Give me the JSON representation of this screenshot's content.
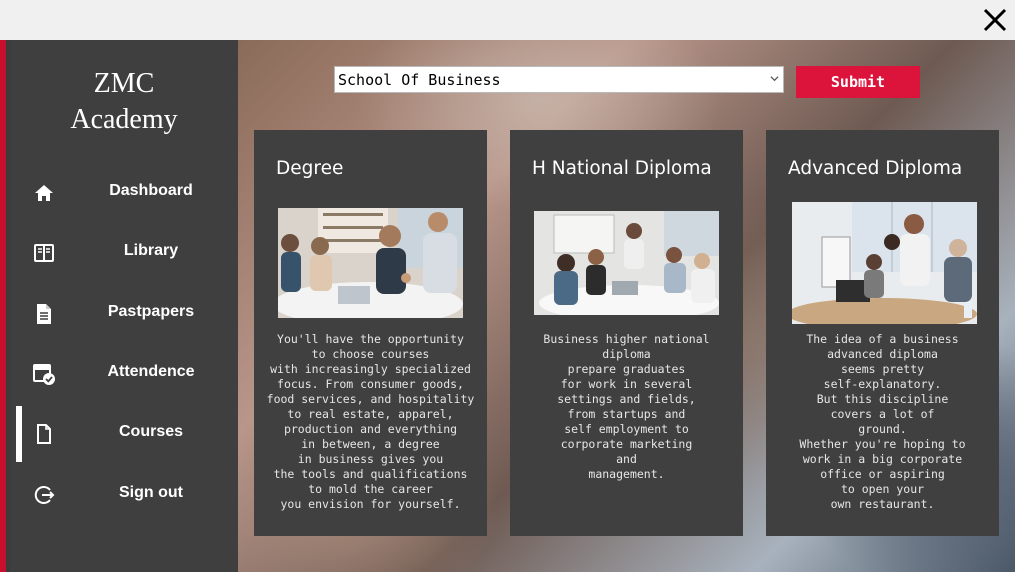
{
  "window": {
    "close_icon": "close-x-icon"
  },
  "sidebar": {
    "brand_line1": "ZMC",
    "brand_line2": "Academy",
    "items": [
      {
        "label": "Dashboard",
        "icon": "home-icon"
      },
      {
        "label": "Library",
        "icon": "book-icon"
      },
      {
        "label": "Pastpapers",
        "icon": "document-icon"
      },
      {
        "label": "Attendence",
        "icon": "calendar-check-icon"
      },
      {
        "label": "Courses",
        "icon": "file-icon",
        "active": true
      },
      {
        "label": "Sign out",
        "icon": "sign-out-icon"
      }
    ]
  },
  "course_select": {
    "value": "School Of Business"
  },
  "submit_label": "Submit",
  "cards": [
    {
      "title": "Degree",
      "photo": "business-meeting-photo",
      "text": "You'll have the opportunity\nto choose courses\nwith increasingly specialized\nfocus. From consumer goods,\nfood services, and hospitality\nto real estate, apparel,\nproduction and everything\nin between, a degree\nin business gives you\nthe tools and qualifications\nto mold the career\nyou envision for yourself."
    },
    {
      "title": "H National Diploma",
      "photo": "team-meeting-photo",
      "text": "Business higher national\ndiploma\nprepare graduates\nfor work in several\nsettings and fields,\nfrom startups and\nself employment to\ncorporate marketing\nand\nmanagement."
    },
    {
      "title": "Advanced Diploma",
      "photo": "office-discussion-photo",
      "text": "The idea of a business\nadvanced diploma\nseems pretty\nself-explanatory.\nBut this discipline\ncovers a lot of\nground.\nWhether you're hoping to\nwork in a big corporate\noffice or aspiring\nto open your\nown restaurant."
    }
  ],
  "colors": {
    "sidebar_bg": "#3f3f3f",
    "card_bg": "#404040",
    "accent": "#dc143c"
  }
}
